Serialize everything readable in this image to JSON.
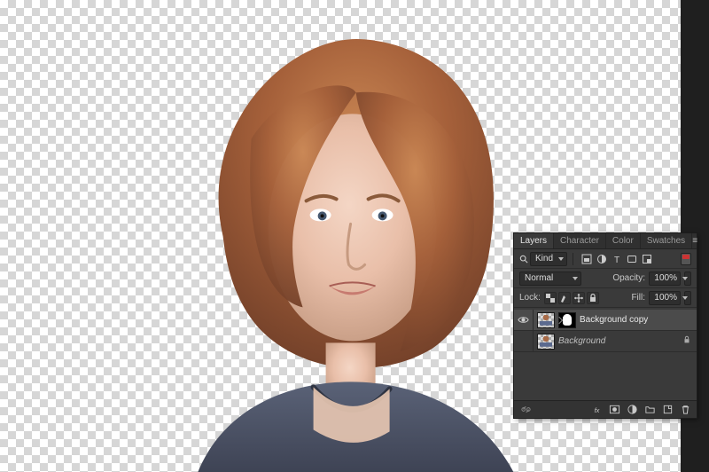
{
  "panel": {
    "tabs": [
      "Layers",
      "Character",
      "Color",
      "Swatches"
    ],
    "active_tab_index": 0,
    "filter": {
      "kind_label": "Kind"
    },
    "blend": {
      "mode": "Normal",
      "opacity_label": "Opacity:",
      "opacity_value": "100%"
    },
    "lock": {
      "label": "Lock:",
      "fill_label": "Fill:",
      "fill_value": "100%"
    }
  },
  "layers": [
    {
      "name": "Background copy",
      "visible": true,
      "selected": true,
      "has_mask": true,
      "italic": false,
      "locked": false
    },
    {
      "name": "Background",
      "visible": false,
      "selected": false,
      "has_mask": false,
      "italic": true,
      "locked": true
    }
  ],
  "icons": {
    "menu": "≡",
    "eye": "eye",
    "padlock": "lock"
  }
}
